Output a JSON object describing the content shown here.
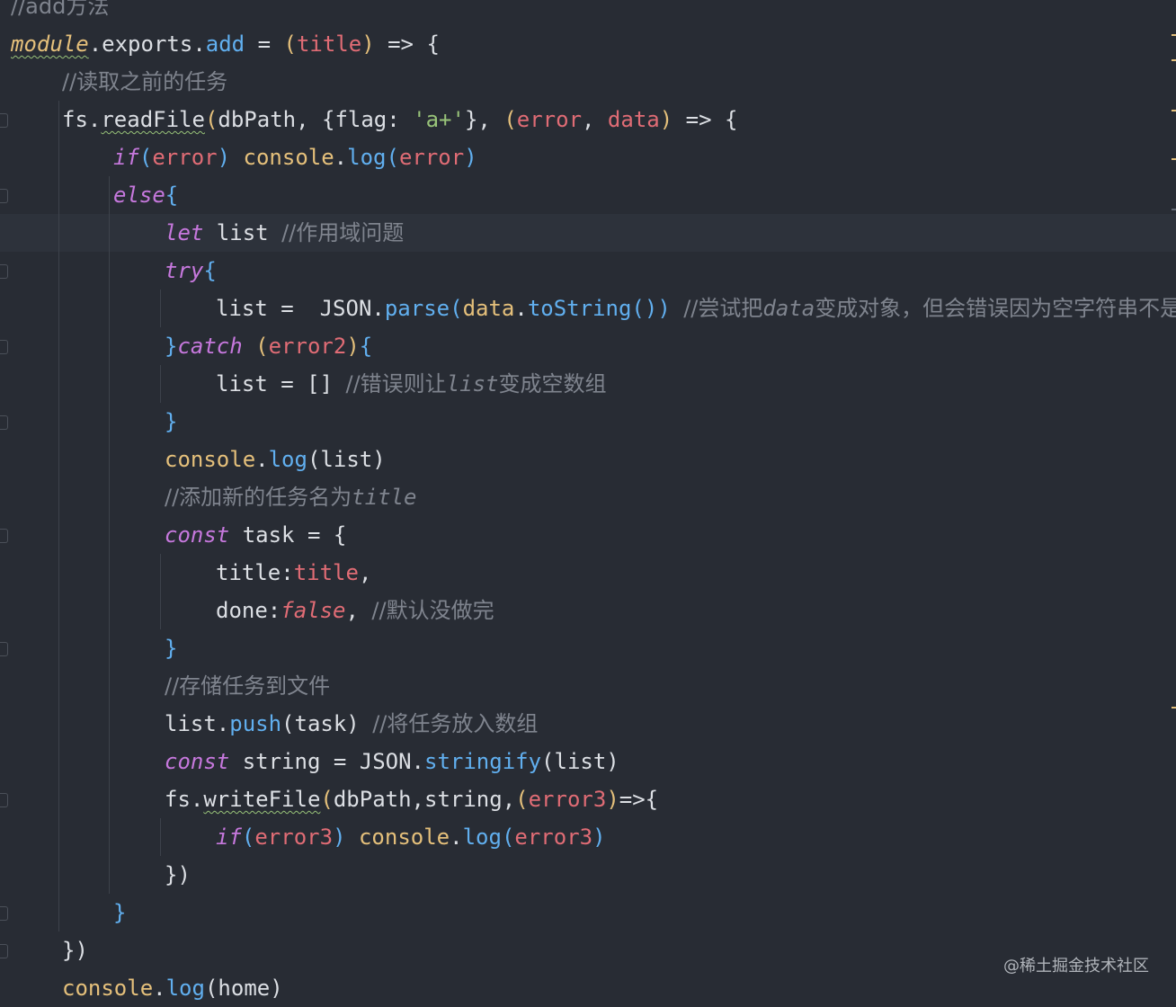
{
  "lines": [
    {
      "indent": 0,
      "tokens": [
        {
          "t": "//add方法",
          "c": "comment"
        }
      ]
    },
    {
      "indent": 0,
      "tokens": [
        {
          "t": "module",
          "c": "mod squiggle"
        },
        {
          "t": ".",
          "c": "plain"
        },
        {
          "t": "exports",
          "c": "plain"
        },
        {
          "t": ".",
          "c": "plain"
        },
        {
          "t": "add",
          "c": "fn"
        },
        {
          "t": " = ",
          "c": "plain"
        },
        {
          "t": "(",
          "c": "obj"
        },
        {
          "t": "title",
          "c": "param"
        },
        {
          "t": ")",
          "c": "obj"
        },
        {
          "t": " => {",
          "c": "plain"
        }
      ]
    },
    {
      "indent": 1,
      "tokens": [
        {
          "t": "//读取之前的任务",
          "c": "comment"
        }
      ]
    },
    {
      "indent": 1,
      "tokens": [
        {
          "t": "fs",
          "c": "plain"
        },
        {
          "t": ".",
          "c": "plain"
        },
        {
          "t": "readFile",
          "c": "plain squiggle"
        },
        {
          "t": "(",
          "c": "obj"
        },
        {
          "t": "dbPath, {flag: ",
          "c": "plain"
        },
        {
          "t": "'a+'",
          "c": "str"
        },
        {
          "t": "}, ",
          "c": "plain"
        },
        {
          "t": "(",
          "c": "obj"
        },
        {
          "t": "error",
          "c": "param"
        },
        {
          "t": ", ",
          "c": "plain"
        },
        {
          "t": "data",
          "c": "param"
        },
        {
          "t": ")",
          "c": "obj"
        },
        {
          "t": " => {",
          "c": "plain"
        }
      ]
    },
    {
      "indent": 2,
      "tokens": [
        {
          "t": "if",
          "c": "kw"
        },
        {
          "t": "(",
          "c": "fn"
        },
        {
          "t": "error",
          "c": "param"
        },
        {
          "t": ")",
          "c": "fn"
        },
        {
          "t": " ",
          "c": "plain"
        },
        {
          "t": "console",
          "c": "obj"
        },
        {
          "t": ".",
          "c": "plain"
        },
        {
          "t": "log",
          "c": "fn"
        },
        {
          "t": "(",
          "c": "fn"
        },
        {
          "t": "error",
          "c": "param"
        },
        {
          "t": ")",
          "c": "fn"
        }
      ]
    },
    {
      "indent": 2,
      "tokens": [
        {
          "t": "else",
          "c": "kw"
        },
        {
          "t": "{",
          "c": "fn"
        }
      ]
    },
    {
      "indent": 3,
      "active": true,
      "tokens": [
        {
          "t": "let",
          "c": "kw"
        },
        {
          "t": " list ",
          "c": "plain"
        },
        {
          "t": "//作用域问题",
          "c": "comment"
        }
      ]
    },
    {
      "indent": 3,
      "tokens": [
        {
          "t": "try",
          "c": "kw"
        },
        {
          "t": "{",
          "c": "fn"
        }
      ]
    },
    {
      "indent": 4,
      "tokens": [
        {
          "t": "list = ",
          "c": "plain"
        },
        {
          "t": " JSON",
          "c": "plain"
        },
        {
          "t": ".",
          "c": "plain"
        },
        {
          "t": "parse",
          "c": "fn"
        },
        {
          "t": "(",
          "c": "fn"
        },
        {
          "t": "data",
          "c": "obj"
        },
        {
          "t": ".",
          "c": "plain"
        },
        {
          "t": "toString",
          "c": "fn"
        },
        {
          "t": "()",
          "c": "fn"
        },
        {
          "t": ")",
          "c": "fn"
        },
        {
          "t": " ",
          "c": "plain"
        },
        {
          "t": "//尝试把",
          "c": "comment"
        },
        {
          "t": "data",
          "c": "comment-i"
        },
        {
          "t": "变成对象，但会错误因为空字符串不是合法的JSON",
          "c": "comment"
        }
      ]
    },
    {
      "indent": 3,
      "tokens": [
        {
          "t": "}",
          "c": "fn"
        },
        {
          "t": "catch",
          "c": "kw"
        },
        {
          "t": " ",
          "c": "plain"
        },
        {
          "t": "(",
          "c": "obj"
        },
        {
          "t": "error2",
          "c": "param"
        },
        {
          "t": ")",
          "c": "obj"
        },
        {
          "t": "{",
          "c": "fn"
        }
      ]
    },
    {
      "indent": 4,
      "tokens": [
        {
          "t": "list = [] ",
          "c": "plain"
        },
        {
          "t": "//错误则让",
          "c": "comment"
        },
        {
          "t": "list",
          "c": "comment-i"
        },
        {
          "t": "变成空数组",
          "c": "comment"
        }
      ]
    },
    {
      "indent": 3,
      "tokens": [
        {
          "t": "}",
          "c": "fn"
        }
      ]
    },
    {
      "indent": 3,
      "tokens": [
        {
          "t": "console",
          "c": "obj"
        },
        {
          "t": ".",
          "c": "plain"
        },
        {
          "t": "log",
          "c": "fn"
        },
        {
          "t": "(",
          "c": "plain"
        },
        {
          "t": "list",
          "c": "plain"
        },
        {
          "t": ")",
          "c": "plain"
        }
      ]
    },
    {
      "indent": 3,
      "tokens": [
        {
          "t": "//添加新的任务名为",
          "c": "comment"
        },
        {
          "t": "title",
          "c": "comment-i"
        }
      ]
    },
    {
      "indent": 3,
      "tokens": [
        {
          "t": "const",
          "c": "kw"
        },
        {
          "t": " task = {",
          "c": "plain"
        }
      ]
    },
    {
      "indent": 4,
      "tokens": [
        {
          "t": "title:",
          "c": "plain"
        },
        {
          "t": "title",
          "c": "param"
        },
        {
          "t": ",",
          "c": "plain"
        }
      ]
    },
    {
      "indent": 4,
      "tokens": [
        {
          "t": "done:",
          "c": "plain"
        },
        {
          "t": "false",
          "c": "bool"
        },
        {
          "t": ", ",
          "c": "plain"
        },
        {
          "t": "//默认没做完",
          "c": "comment"
        }
      ]
    },
    {
      "indent": 3,
      "tokens": [
        {
          "t": "}",
          "c": "fn"
        }
      ]
    },
    {
      "indent": 3,
      "tokens": [
        {
          "t": "//存储任务到文件",
          "c": "comment"
        }
      ]
    },
    {
      "indent": 3,
      "tokens": [
        {
          "t": "list",
          "c": "plain"
        },
        {
          "t": ".",
          "c": "plain"
        },
        {
          "t": "push",
          "c": "fn"
        },
        {
          "t": "(",
          "c": "plain"
        },
        {
          "t": "task",
          "c": "plain"
        },
        {
          "t": ")",
          "c": "plain"
        },
        {
          "t": " ",
          "c": "plain"
        },
        {
          "t": "//将任务放入数组",
          "c": "comment"
        }
      ]
    },
    {
      "indent": 3,
      "tokens": [
        {
          "t": "const",
          "c": "kw"
        },
        {
          "t": " string = JSON",
          "c": "plain"
        },
        {
          "t": ".",
          "c": "plain"
        },
        {
          "t": "stringify",
          "c": "fn"
        },
        {
          "t": "(",
          "c": "plain"
        },
        {
          "t": "list",
          "c": "plain"
        },
        {
          "t": ")",
          "c": "plain"
        }
      ]
    },
    {
      "indent": 3,
      "tokens": [
        {
          "t": "fs",
          "c": "plain"
        },
        {
          "t": ".",
          "c": "plain"
        },
        {
          "t": "writeFile",
          "c": "plain squiggle"
        },
        {
          "t": "(",
          "c": "obj"
        },
        {
          "t": "dbPath,string,",
          "c": "plain"
        },
        {
          "t": "(",
          "c": "obj"
        },
        {
          "t": "error3",
          "c": "param"
        },
        {
          "t": ")",
          "c": "obj"
        },
        {
          "t": "=>{",
          "c": "plain"
        }
      ]
    },
    {
      "indent": 4,
      "tokens": [
        {
          "t": "if",
          "c": "kw"
        },
        {
          "t": "(",
          "c": "fn"
        },
        {
          "t": "error3",
          "c": "param"
        },
        {
          "t": ")",
          "c": "fn"
        },
        {
          "t": " ",
          "c": "plain"
        },
        {
          "t": "console",
          "c": "obj"
        },
        {
          "t": ".",
          "c": "plain"
        },
        {
          "t": "log",
          "c": "fn"
        },
        {
          "t": "(",
          "c": "fn"
        },
        {
          "t": "error3",
          "c": "param"
        },
        {
          "t": ")",
          "c": "fn"
        }
      ]
    },
    {
      "indent": 3,
      "tokens": [
        {
          "t": "})",
          "c": "plain"
        }
      ]
    },
    {
      "indent": 2,
      "tokens": [
        {
          "t": "}",
          "c": "fn"
        }
      ]
    },
    {
      "indent": 1,
      "tokens": [
        {
          "t": "})",
          "c": "plain"
        }
      ]
    },
    {
      "indent": 1,
      "tokens": [
        {
          "t": "console",
          "c": "obj"
        },
        {
          "t": ".",
          "c": "plain"
        },
        {
          "t": "log",
          "c": "fn"
        },
        {
          "t": "(",
          "c": "plain"
        },
        {
          "t": "home",
          "c": "plain"
        },
        {
          "t": ")",
          "c": "plain"
        }
      ]
    }
  ],
  "watermark": "@稀土掘金技术社区"
}
